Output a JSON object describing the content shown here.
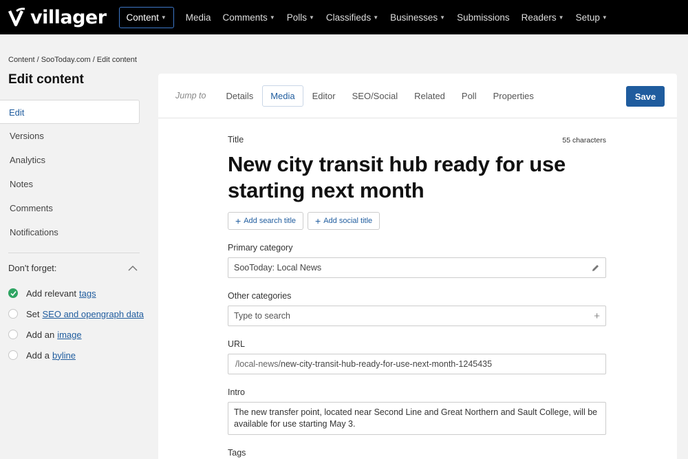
{
  "brand": {
    "name": "villager"
  },
  "nav": {
    "items": [
      {
        "label": "Content",
        "active": true,
        "dropdown": true
      },
      {
        "label": "Media",
        "active": false,
        "dropdown": false
      },
      {
        "label": "Comments",
        "active": false,
        "dropdown": true
      },
      {
        "label": "Polls",
        "active": false,
        "dropdown": true
      },
      {
        "label": "Classifieds",
        "active": false,
        "dropdown": true
      },
      {
        "label": "Businesses",
        "active": false,
        "dropdown": true
      },
      {
        "label": "Submissions",
        "active": false,
        "dropdown": false
      },
      {
        "label": "Readers",
        "active": false,
        "dropdown": true
      },
      {
        "label": "Setup",
        "active": false,
        "dropdown": true
      }
    ]
  },
  "breadcrumb": "Content / SooToday.com / Edit content",
  "page_title": "Edit content",
  "sidebar": {
    "items": [
      {
        "label": "Edit",
        "active": true
      },
      {
        "label": "Versions",
        "active": false
      },
      {
        "label": "Analytics",
        "active": false
      },
      {
        "label": "Notes",
        "active": false
      },
      {
        "label": "Comments",
        "active": false
      },
      {
        "label": "Notifications",
        "active": false
      }
    ]
  },
  "dont_forget": {
    "heading": "Don't forget:",
    "items": [
      {
        "prefix": "Add relevant",
        "link": "tags",
        "done": true
      },
      {
        "prefix": "Set",
        "link": "SEO and opengraph data",
        "done": false
      },
      {
        "prefix": "Add an",
        "link": "image",
        "done": false
      },
      {
        "prefix": "Add a",
        "link": "byline",
        "done": false
      }
    ]
  },
  "tabs": {
    "jump_label": "Jump to",
    "items": [
      {
        "label": "Details",
        "active": false
      },
      {
        "label": "Media",
        "active": true
      },
      {
        "label": "Editor",
        "active": false
      },
      {
        "label": "SEO/Social",
        "active": false
      },
      {
        "label": "Related",
        "active": false
      },
      {
        "label": "Poll",
        "active": false
      },
      {
        "label": "Properties",
        "active": false
      }
    ],
    "save_label": "Save"
  },
  "form": {
    "title_label": "Title",
    "char_count": "55 characters",
    "title_value": "New city transit hub ready for use starting next month",
    "add_search_title": "Add search title",
    "add_social_title": "Add social title",
    "primary_category_label": "Primary category",
    "primary_category_value": "SooToday: Local News",
    "other_categories_label": "Other categories",
    "other_categories_placeholder": "Type to search",
    "url_label": "URL",
    "url_prefix": "/local-news/",
    "url_slug": "new-city-transit-hub-ready-for-use-next-month-1245435",
    "intro_label": "Intro",
    "intro_value": "The new transfer point, located near Second Line and Great Northern and Sault College, will be available for use starting May 3.",
    "tags_label": "Tags"
  },
  "colors": {
    "accent": "#1f5c9e",
    "done": "#2fa463",
    "nav_bg": "#000000"
  }
}
